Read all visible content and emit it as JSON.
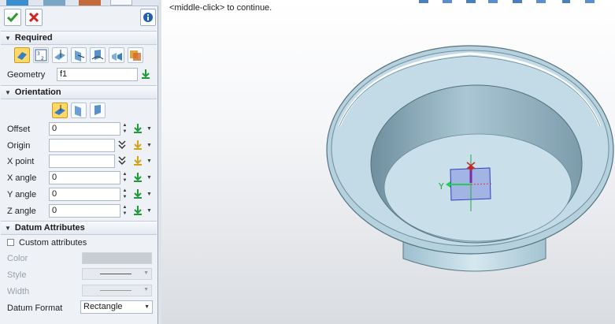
{
  "prompt": "<middle-click> to continue.",
  "panel": {
    "sections": {
      "required": "Required",
      "orientation": "Orientation",
      "datum_attributes": "Datum Attributes"
    },
    "geometry": {
      "label": "Geometry",
      "value": "f1"
    },
    "fields": {
      "offset": {
        "label": "Offset",
        "value": "0"
      },
      "origin": {
        "label": "Origin",
        "value": ""
      },
      "x_point": {
        "label": "X point",
        "value": ""
      },
      "x_angle": {
        "label": "X angle",
        "value": "0"
      },
      "y_angle": {
        "label": "Y angle",
        "value": "0"
      },
      "z_angle": {
        "label": "Z angle",
        "value": "0"
      }
    },
    "attributes": {
      "custom": "Custom attributes",
      "color": "Color",
      "style": "Style",
      "width": "Width",
      "datum_format": "Datum Format",
      "datum_format_value": "Rectangle"
    }
  },
  "colors": {
    "accent": "#ffd86a",
    "ok": "#2e9a2e",
    "cancel": "#d42020",
    "model": "#b9d3df"
  }
}
